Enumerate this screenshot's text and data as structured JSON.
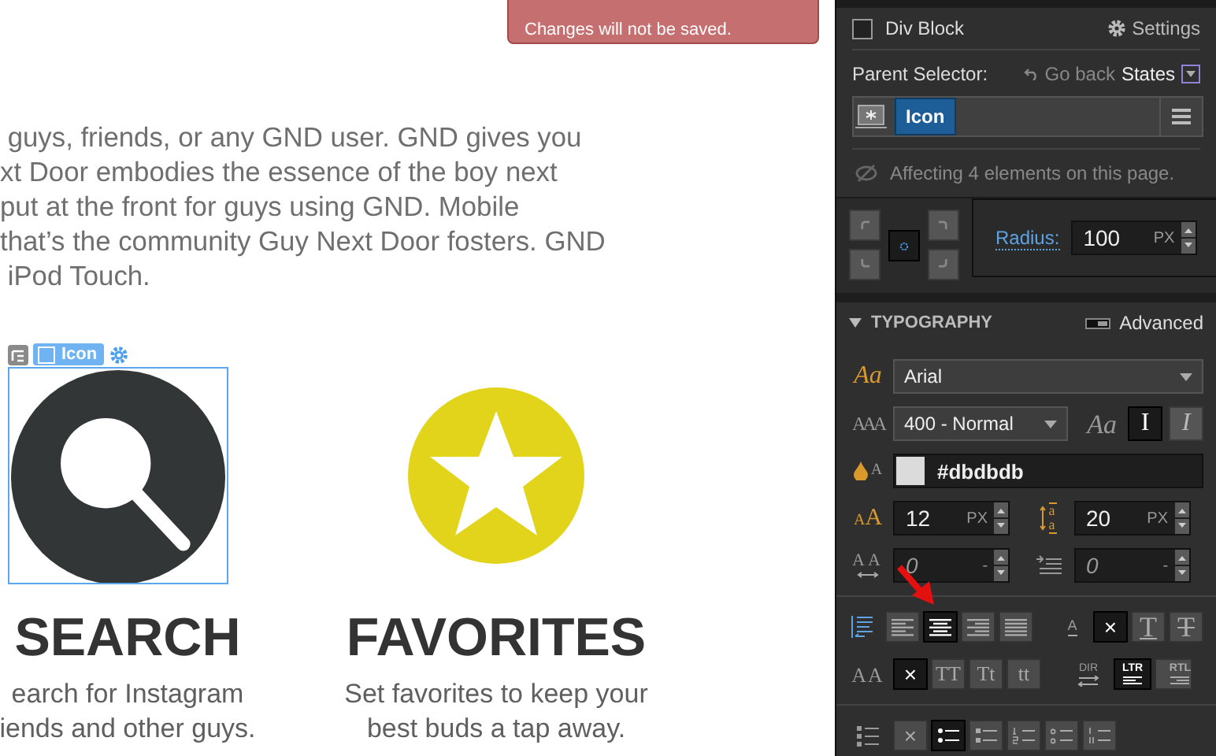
{
  "alert": {
    "message": "Changes will not be saved."
  },
  "canvas": {
    "paragraph_lines": [
      " guys, friends, or any GND user. GND gives you",
      "xt Door embodies the essence of the boy next",
      "put at the front for guys using GND. Mobile",
      "that’s the community Guy Next Door fosters. GND",
      " iPod Touch."
    ],
    "selection_tag": {
      "label": "Icon"
    },
    "cards": [
      {
        "kind": "search",
        "title": "SEARCH",
        "description_lines": [
          "earch for Instagram",
          "iends and other guys."
        ],
        "selected": true
      },
      {
        "kind": "favorites",
        "title": "FAVORITES",
        "description_lines": [
          "Set favorites to keep your",
          "best buds a tap away."
        ],
        "selected": false
      }
    ]
  },
  "panel": {
    "element": {
      "label": "Div Block",
      "checked": false,
      "settings": "Settings"
    },
    "parent_selector": {
      "label": "Parent Selector:",
      "go_back": "Go back",
      "states": "States",
      "chip": "Icon"
    },
    "affecting": "Affecting 4 elements on this page.",
    "radius": {
      "corners": [
        {
          "kind": "top-left",
          "selected": false
        },
        {
          "kind": "all",
          "selected": true
        },
        {
          "kind": "top-right",
          "selected": false
        },
        {
          "kind": "bottom-left",
          "selected": false
        },
        {
          "kind": "bottom-right",
          "selected": false
        }
      ],
      "label": "Radius:",
      "value": "100",
      "unit": "PX"
    },
    "typography": {
      "title": "TYPOGRAPHY",
      "advanced_label": "Advanced",
      "advanced_on": false,
      "font": "Arial",
      "weight": "400 - Normal",
      "styles": [
        {
          "kind": "normal",
          "label": "I",
          "selected": true
        },
        {
          "kind": "italic",
          "label": "I",
          "selected": false
        }
      ],
      "color_hex": "#dbdbdb",
      "icon_glyphs": {
        "font": "Aa",
        "weight": "AAA",
        "style": "Aa",
        "fill": "A",
        "size": "AA",
        "line_height": "aa",
        "letter_spacing": "AA",
        "decoration": "A",
        "transform": "AA",
        "direction": "DIR"
      },
      "size": {
        "value": "12",
        "unit": "PX"
      },
      "line_height": {
        "value": "20",
        "unit": "PX"
      },
      "letter_spacing": {
        "value": "0",
        "unit": "-"
      },
      "text_indent": {
        "value": "0",
        "unit": "-"
      },
      "align": [
        {
          "kind": "left",
          "selected": false
        },
        {
          "kind": "center",
          "selected": true
        },
        {
          "kind": "right",
          "selected": false
        },
        {
          "kind": "justify",
          "selected": false
        }
      ],
      "decoration": [
        {
          "kind": "none",
          "label": "×",
          "selected": true
        },
        {
          "kind": "underline",
          "label": "T",
          "selected": false
        },
        {
          "kind": "strike",
          "label": "T",
          "selected": false
        }
      ],
      "transform": [
        {
          "kind": "none",
          "label": "×",
          "selected": true
        },
        {
          "kind": "upper",
          "label": "TT",
          "selected": false
        },
        {
          "kind": "capitalize",
          "label": "Tt",
          "selected": false
        },
        {
          "kind": "lower",
          "label": "tt",
          "selected": false
        }
      ],
      "direction": [
        {
          "kind": "ltr",
          "label": "LTR",
          "selected": true
        },
        {
          "kind": "rtl",
          "label": "RTL",
          "selected": false
        }
      ],
      "lists": [
        {
          "kind": "none",
          "label": "×",
          "selected": false
        },
        {
          "kind": "bullet",
          "selected": true
        },
        {
          "kind": "square",
          "selected": false
        },
        {
          "kind": "decimal",
          "selected": false
        },
        {
          "kind": "alpha",
          "selected": false
        },
        {
          "kind": "roman",
          "selected": false
        }
      ]
    }
  }
}
